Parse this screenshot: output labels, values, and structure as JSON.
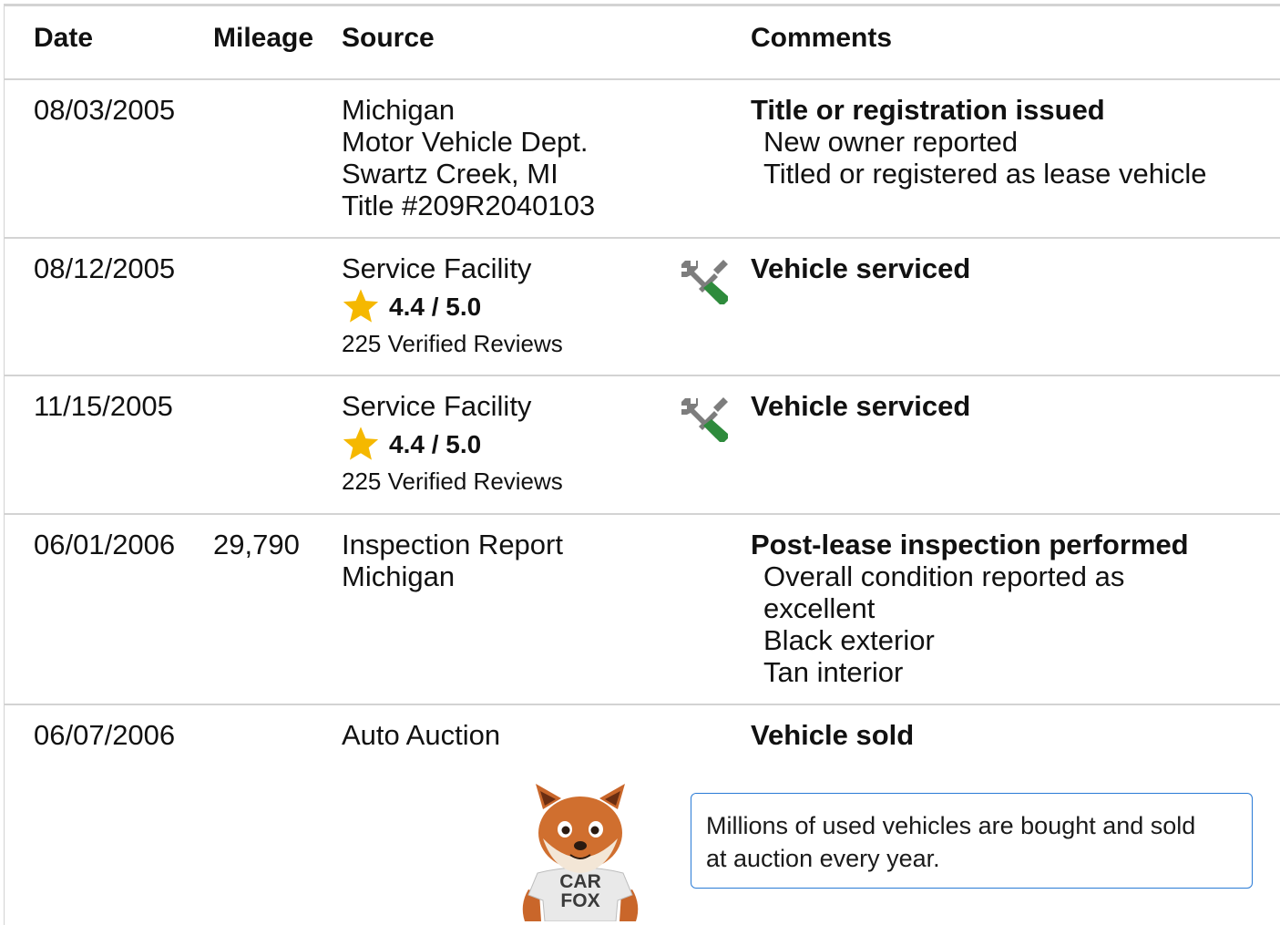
{
  "headers": {
    "date": "Date",
    "mileage": "Mileage",
    "source": "Source",
    "comments": "Comments"
  },
  "rows": [
    {
      "date": "08/03/2005",
      "mileage": "",
      "source": [
        "Michigan",
        "Motor Vehicle Dept.",
        "Swartz Creek, MI",
        "Title #209R2040103"
      ],
      "comment_title": "Title or registration issued",
      "comment_details": [
        "New owner reported",
        "Titled or registered as lease vehicle"
      ]
    },
    {
      "date": "08/12/2005",
      "mileage": "",
      "source": [
        "Service Facility"
      ],
      "rating": "4.4 / 5.0",
      "reviews": "225 Verified Reviews",
      "icon": "service-tools-icon",
      "comment_title": "Vehicle serviced"
    },
    {
      "date": "11/15/2005",
      "mileage": "",
      "source": [
        "Service Facility"
      ],
      "rating": "4.4 / 5.0",
      "reviews": "225 Verified Reviews",
      "icon": "service-tools-icon",
      "comment_title": "Vehicle serviced"
    },
    {
      "date": "06/01/2006",
      "mileage": "29,790",
      "source": [
        "Inspection Report",
        "Michigan"
      ],
      "comment_title": "Post-lease inspection performed",
      "comment_details": [
        "Overall condition reported as",
        "excellent",
        "Black exterior",
        "Tan interior"
      ]
    },
    {
      "date": "06/07/2006",
      "mileage": "",
      "source": [
        "Auto Auction"
      ],
      "comment_title": "Vehicle sold"
    }
  ],
  "tip": {
    "text_line1": "Millions of used vehicles are bought and sold",
    "text_line2": "at auction every year."
  },
  "mascot": {
    "shirt_line1": "CAR",
    "shirt_line2": "FOX"
  },
  "colors": {
    "star": "#f5b800",
    "tool_gray": "#7d7d7d",
    "tool_green": "#2e8b3c",
    "tip_border": "#2a7bd6",
    "divider": "#d3d3d3"
  }
}
